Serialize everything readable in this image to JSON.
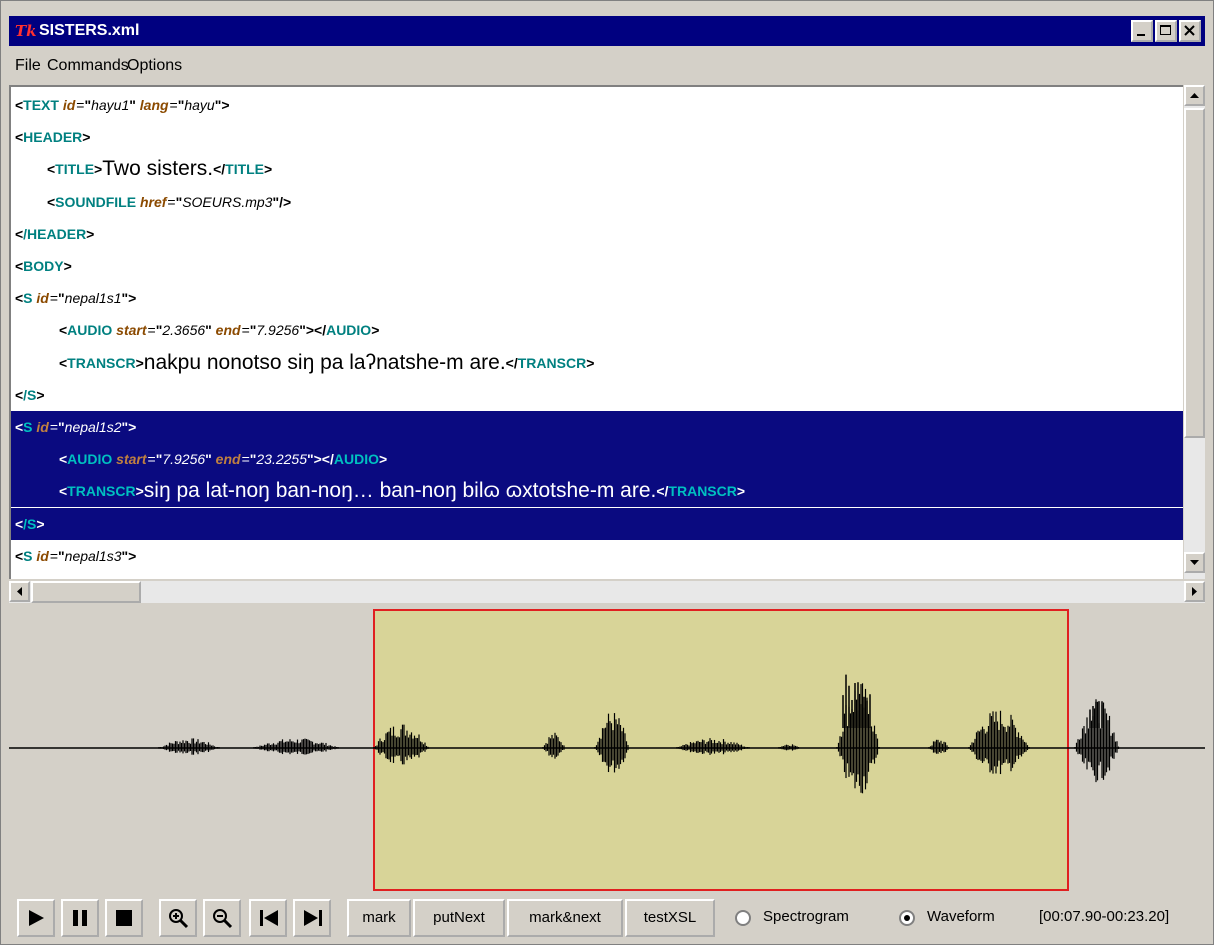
{
  "window": {
    "title": "SISTERS.xml",
    "icon_text": "Tk",
    "controls": [
      "minimize",
      "maximize",
      "close"
    ]
  },
  "menu": {
    "items": [
      "File",
      "Commands",
      "Options"
    ]
  },
  "editor": {
    "selected_line_index": 11,
    "lines": [
      {
        "indent": 0,
        "open_tag": "TEXT",
        "attrs": [
          {
            "name": "id",
            "value": "hayu1"
          },
          {
            "name": "lang",
            "value": "hayu"
          }
        ],
        "text": "",
        "close_tag": "",
        "self_close": false
      },
      {
        "indent": 0,
        "open_tag": "HEADER",
        "attrs": [],
        "text": "",
        "close_tag": "",
        "self_close": false
      },
      {
        "indent": 1,
        "open_tag": "TITLE",
        "attrs": [],
        "text": "Two sisters.",
        "close_tag": "TITLE",
        "self_close": false
      },
      {
        "indent": 1,
        "open_tag": "SOUNDFILE",
        "attrs": [
          {
            "name": "href",
            "value": "SOEURS.mp3"
          }
        ],
        "text": "",
        "close_tag": "",
        "self_close": true
      },
      {
        "indent": 0,
        "open_tag": "/HEADER",
        "attrs": [],
        "text": "",
        "close_tag": "",
        "self_close": false
      },
      {
        "indent": 0,
        "open_tag": "BODY",
        "attrs": [],
        "text": "",
        "close_tag": "",
        "self_close": false
      },
      {
        "indent": 0,
        "open_tag": "S",
        "attrs": [
          {
            "name": "id",
            "value": "nepal1s1"
          }
        ],
        "text": "",
        "close_tag": "",
        "self_close": false
      },
      {
        "indent": 2,
        "open_tag": "AUDIO",
        "attrs": [
          {
            "name": "start",
            "value": "2.3656"
          },
          {
            "name": "end",
            "value": "7.9256"
          }
        ],
        "text": "",
        "close_tag": "AUDIO",
        "self_close": false
      },
      {
        "indent": 2,
        "open_tag": "TRANSCR",
        "attrs": [],
        "text": "nakpu nonotso siŋ pa laʔnatshe-m are.",
        "close_tag": "TRANSCR",
        "self_close": false
      },
      {
        "indent": 0,
        "open_tag": "/S",
        "attrs": [],
        "text": "",
        "close_tag": "",
        "self_close": false
      },
      {
        "indent": 0,
        "open_tag": "S",
        "attrs": [
          {
            "name": "id",
            "value": "nepal1s2"
          }
        ],
        "text": "",
        "close_tag": "",
        "self_close": false
      },
      {
        "indent": 2,
        "open_tag": "AUDIO",
        "attrs": [
          {
            "name": "start",
            "value": "7.9256"
          },
          {
            "name": "end",
            "value": "23.2255"
          }
        ],
        "text": "",
        "close_tag": "AUDIO",
        "self_close": false
      },
      {
        "indent": 2,
        "open_tag": "TRANSCR",
        "attrs": [],
        "text": "siŋ pa lat-noŋ ban-noŋ… ban-noŋ bilɷ ɷxtotshe-m are.",
        "close_tag": "TRANSCR",
        "self_close": false
      },
      {
        "indent": 0,
        "open_tag": "/S",
        "attrs": [],
        "text": "",
        "close_tag": "",
        "self_close": false
      },
      {
        "indent": 0,
        "open_tag": "S",
        "attrs": [
          {
            "name": "id",
            "value": "nepal1s3"
          }
        ],
        "text": "",
        "close_tag": "",
        "self_close": false
      }
    ],
    "selected_range": [
      10,
      13
    ]
  },
  "toolbar": {
    "icon_buttons": [
      {
        "name": "play-icon",
        "icon": "play"
      },
      {
        "name": "pause-icon",
        "icon": "pause"
      },
      {
        "name": "stop-icon",
        "icon": "stop"
      },
      {
        "name": "zoom-in-icon",
        "icon": "zoom-in"
      },
      {
        "name": "zoom-out-icon",
        "icon": "zoom-out"
      },
      {
        "name": "skip-back-icon",
        "icon": "skip-back"
      },
      {
        "name": "skip-forward-icon",
        "icon": "skip-forward"
      }
    ],
    "text_buttons": [
      "mark",
      "putNext",
      "mark&next",
      "testXSL"
    ],
    "view_options": [
      {
        "label": "Spectrogram",
        "selected": false
      },
      {
        "label": "Waveform",
        "selected": true
      }
    ],
    "time_range": "[00:07.90-00:23.20]"
  },
  "colors": {
    "title_bar": "#000080",
    "tag": "#008080",
    "attribute": "#8b4a00",
    "selection": "#0a0a80",
    "region_fill": "#d8d498",
    "region_border": "#e02020"
  }
}
